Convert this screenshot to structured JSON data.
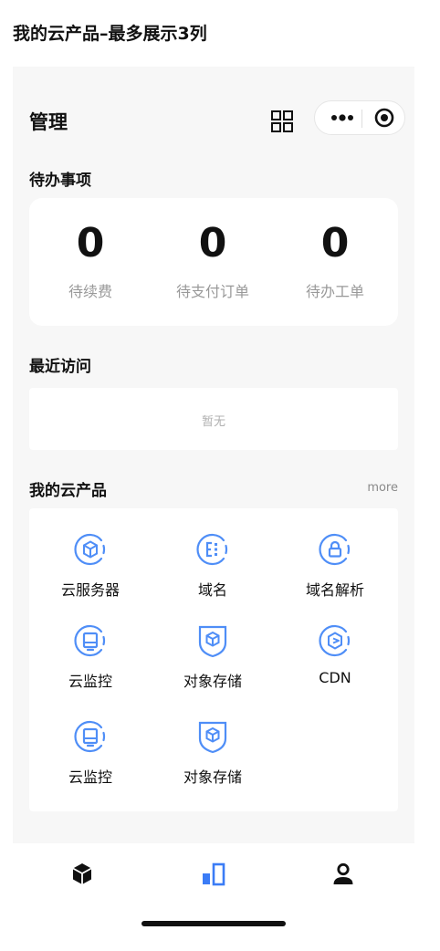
{
  "caption": "我的云产品–最多展示3列",
  "nav": {
    "title": "管理"
  },
  "todo": {
    "title": "待办事项",
    "items": [
      {
        "count": "0",
        "label": "待续费"
      },
      {
        "count": "0",
        "label": "待支付订单"
      },
      {
        "count": "0",
        "label": "待办工单"
      }
    ]
  },
  "recent": {
    "title": "最近访问",
    "empty_text": "暂无"
  },
  "products": {
    "title": "我的云产品",
    "more_label": "more",
    "items": [
      {
        "label": "云服务器",
        "icon": "cloud-server-icon"
      },
      {
        "label": "域名",
        "icon": "domain-icon"
      },
      {
        "label": "域名解析",
        "icon": "domain-resolve-icon"
      },
      {
        "label": "云监控",
        "icon": "cloud-monitor-icon"
      },
      {
        "label": "对象存储",
        "icon": "object-storage-icon"
      },
      {
        "label": "CDN",
        "icon": "cdn-icon"
      },
      {
        "label": "云监控",
        "icon": "cloud-monitor-icon"
      },
      {
        "label": "对象存储",
        "icon": "object-storage-icon"
      }
    ]
  },
  "tabbar": {
    "items": [
      {
        "icon": "cube-icon",
        "active": false
      },
      {
        "icon": "bar-chart-icon",
        "active": true
      },
      {
        "icon": "user-icon",
        "active": false
      }
    ]
  },
  "colors": {
    "accent": "#3b7cf6",
    "icon_blue": "#4f8ef7",
    "page_bg": "#f7f7f7"
  }
}
